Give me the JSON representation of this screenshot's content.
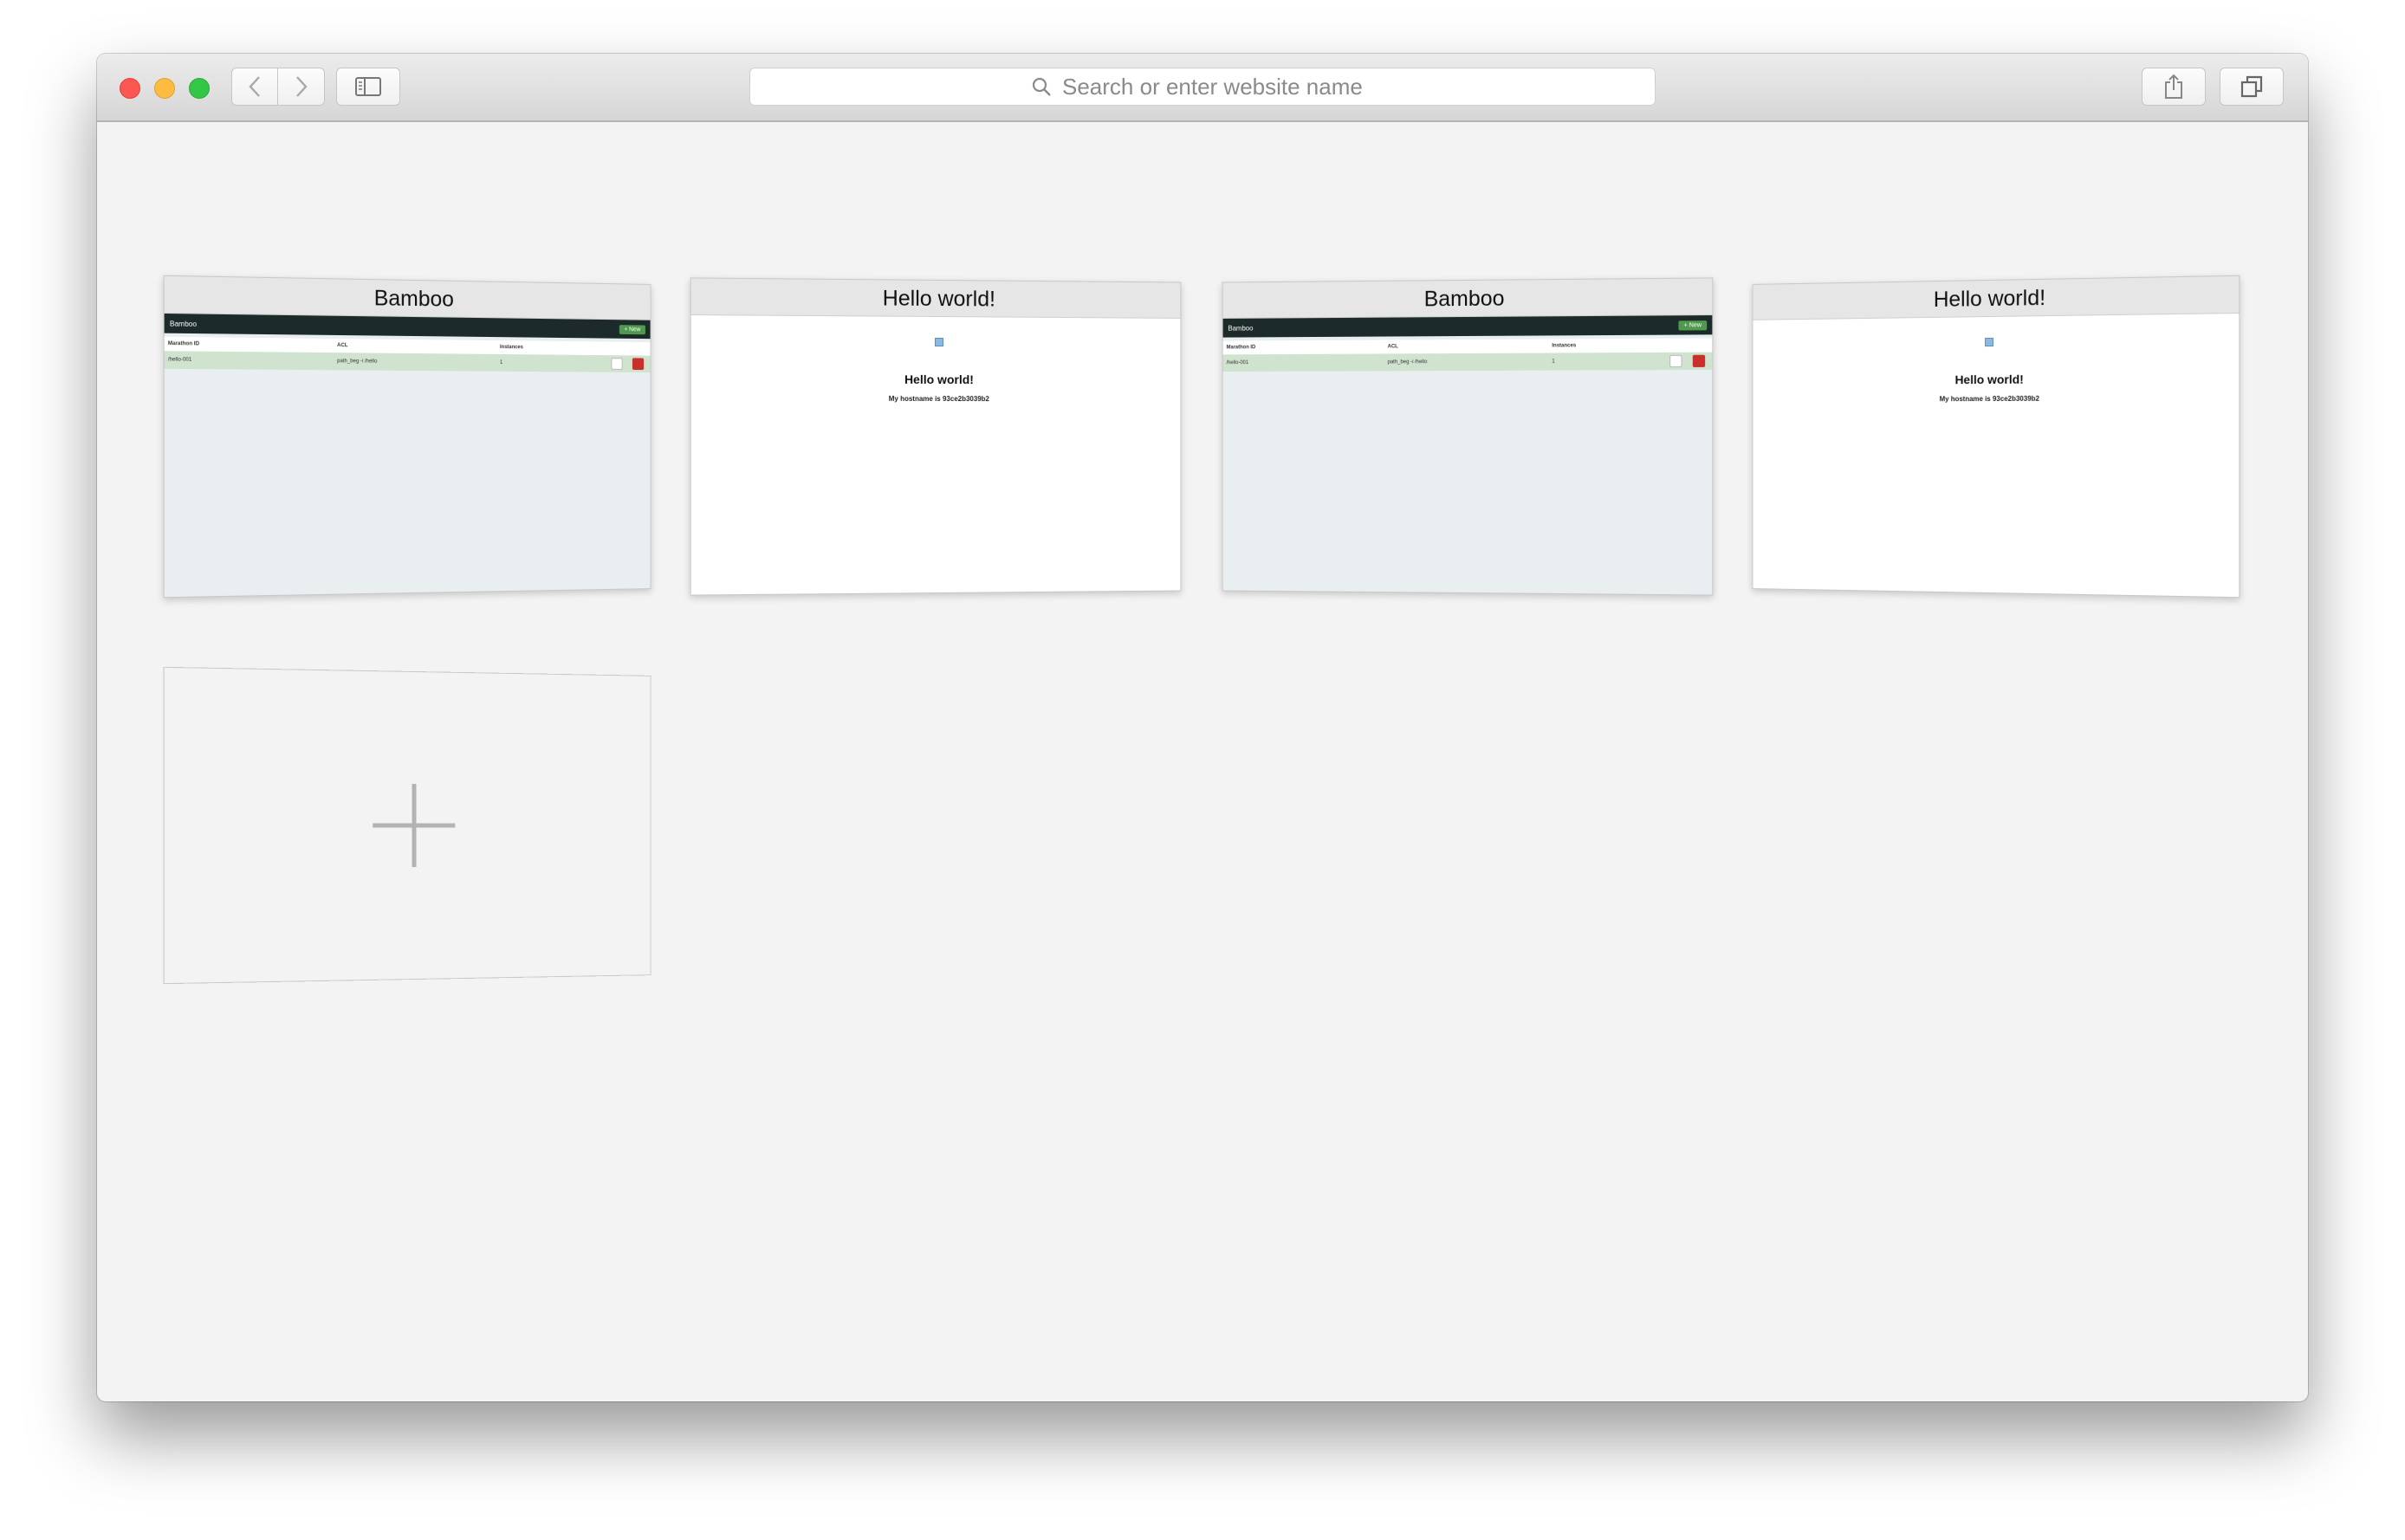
{
  "toolbar": {
    "address_placeholder": "Search or enter website name"
  },
  "favorites": [
    {
      "title": "Bamboo",
      "preview": {
        "brand": "Bamboo",
        "new_button": "+ New",
        "columns": [
          "Marathon ID",
          "ACL",
          "Instances"
        ],
        "row": [
          "/hello-001",
          "path_beg -i /hello",
          "1"
        ]
      }
    },
    {
      "title": "Hello world!",
      "preview": {
        "heading": "Hello world!",
        "text": "My hostname is 93ce2b3039b2"
      }
    },
    {
      "title": "Bamboo",
      "preview": {
        "brand": "Bamboo",
        "new_button": "+ New",
        "columns": [
          "Marathon ID",
          "ACL",
          "Instances"
        ],
        "row": [
          "/hello-001",
          "path_beg -i /hello",
          "1"
        ]
      }
    },
    {
      "title": "Hello world!",
      "preview": {
        "heading": "Hello world!",
        "text": "My hostname is 93ce2b3039b2"
      }
    }
  ],
  "icons": {
    "close": "close-icon",
    "minimize": "minimize-icon",
    "maximize": "maximize-icon",
    "back": "chevron-left-icon",
    "forward": "chevron-right-icon",
    "sidebar": "sidebar-icon",
    "search": "search-icon",
    "share": "share-icon",
    "tabs": "tabs-icon",
    "add": "plus-icon"
  }
}
